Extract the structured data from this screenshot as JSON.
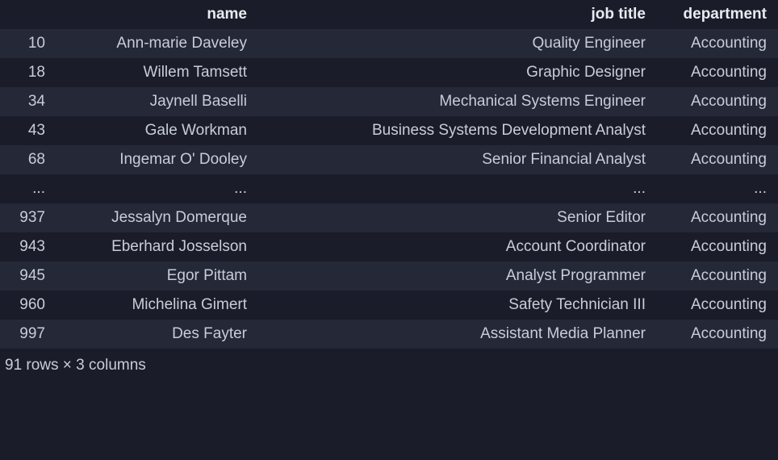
{
  "columns": {
    "index": "",
    "name": "name",
    "job_title": "job title",
    "department": "department"
  },
  "rows": [
    {
      "index": "10",
      "name": "Ann-marie Daveley",
      "job_title": "Quality Engineer",
      "department": "Accounting"
    },
    {
      "index": "18",
      "name": "Willem Tamsett",
      "job_title": "Graphic Designer",
      "department": "Accounting"
    },
    {
      "index": "34",
      "name": "Jaynell Baselli",
      "job_title": "Mechanical Systems Engineer",
      "department": "Accounting"
    },
    {
      "index": "43",
      "name": "Gale Workman",
      "job_title": "Business Systems Development Analyst",
      "department": "Accounting"
    },
    {
      "index": "68",
      "name": "Ingemar O' Dooley",
      "job_title": "Senior Financial Analyst",
      "department": "Accounting"
    }
  ],
  "ellipsis": {
    "index": "...",
    "name": "...",
    "job_title": "...",
    "department": "..."
  },
  "rows2": [
    {
      "index": "937",
      "name": "Jessalyn Domerque",
      "job_title": "Senior Editor",
      "department": "Accounting"
    },
    {
      "index": "943",
      "name": "Eberhard Josselson",
      "job_title": "Account Coordinator",
      "department": "Accounting"
    },
    {
      "index": "945",
      "name": "Egor Pittam",
      "job_title": "Analyst Programmer",
      "department": "Accounting"
    },
    {
      "index": "960",
      "name": "Michelina Gimert",
      "job_title": "Safety Technician III",
      "department": "Accounting"
    },
    {
      "index": "997",
      "name": "Des Fayter",
      "job_title": "Assistant Media Planner",
      "department": "Accounting"
    }
  ],
  "footer": "91 rows × 3 columns"
}
